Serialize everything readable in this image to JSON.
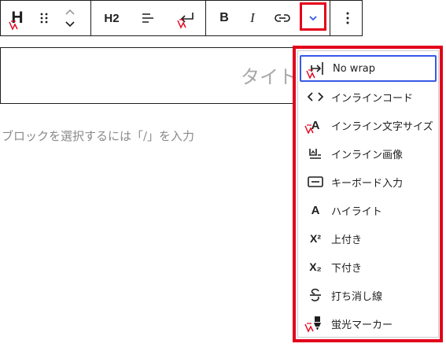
{
  "toolbar": {
    "block_type_label": "H",
    "heading_level_label": "H2",
    "bold_label": "B",
    "italic_label": "I",
    "drag_handle_icon": "drag-handle-icon",
    "move_icon": "up-down-chevron-icon",
    "align_icon": "align-left-icon",
    "wrap_icon": "return-arrow-icon",
    "link_icon": "link-icon",
    "more_icon": "chevron-down-icon",
    "options_icon": "vertical-ellipsis-icon"
  },
  "editor": {
    "title_placeholder": "タイト",
    "block_placeholder": "ブロックを選択するには「/」を入力"
  },
  "format_menu": {
    "items": [
      {
        "label": "No wrap",
        "icon": "no-wrap-icon"
      },
      {
        "label": "インラインコード",
        "icon": "code-brackets-icon"
      },
      {
        "label": "インライン文字サイズ",
        "icon": "font-size-icon"
      },
      {
        "label": "インライン画像",
        "icon": "inline-image-icon"
      },
      {
        "label": "キーボード入力",
        "icon": "keyboard-icon"
      },
      {
        "label": "ハイライト",
        "icon": "highlight-a-icon"
      },
      {
        "label": "上付き",
        "icon": "superscript-icon"
      },
      {
        "label": "下付き",
        "icon": "subscript-icon"
      },
      {
        "label": "打ち消し線",
        "icon": "strikethrough-icon"
      },
      {
        "label": "蛍光マーカー",
        "icon": "marker-icon"
      }
    ],
    "superscript_glyph": "X²",
    "subscript_glyph": "X₂",
    "highlight_glyph": "A",
    "font_size_glyph": "A"
  },
  "colors": {
    "annotation_red": "#e3001b",
    "focus_blue": "#3858e9",
    "placeholder_gray": "#a8a8a8"
  }
}
